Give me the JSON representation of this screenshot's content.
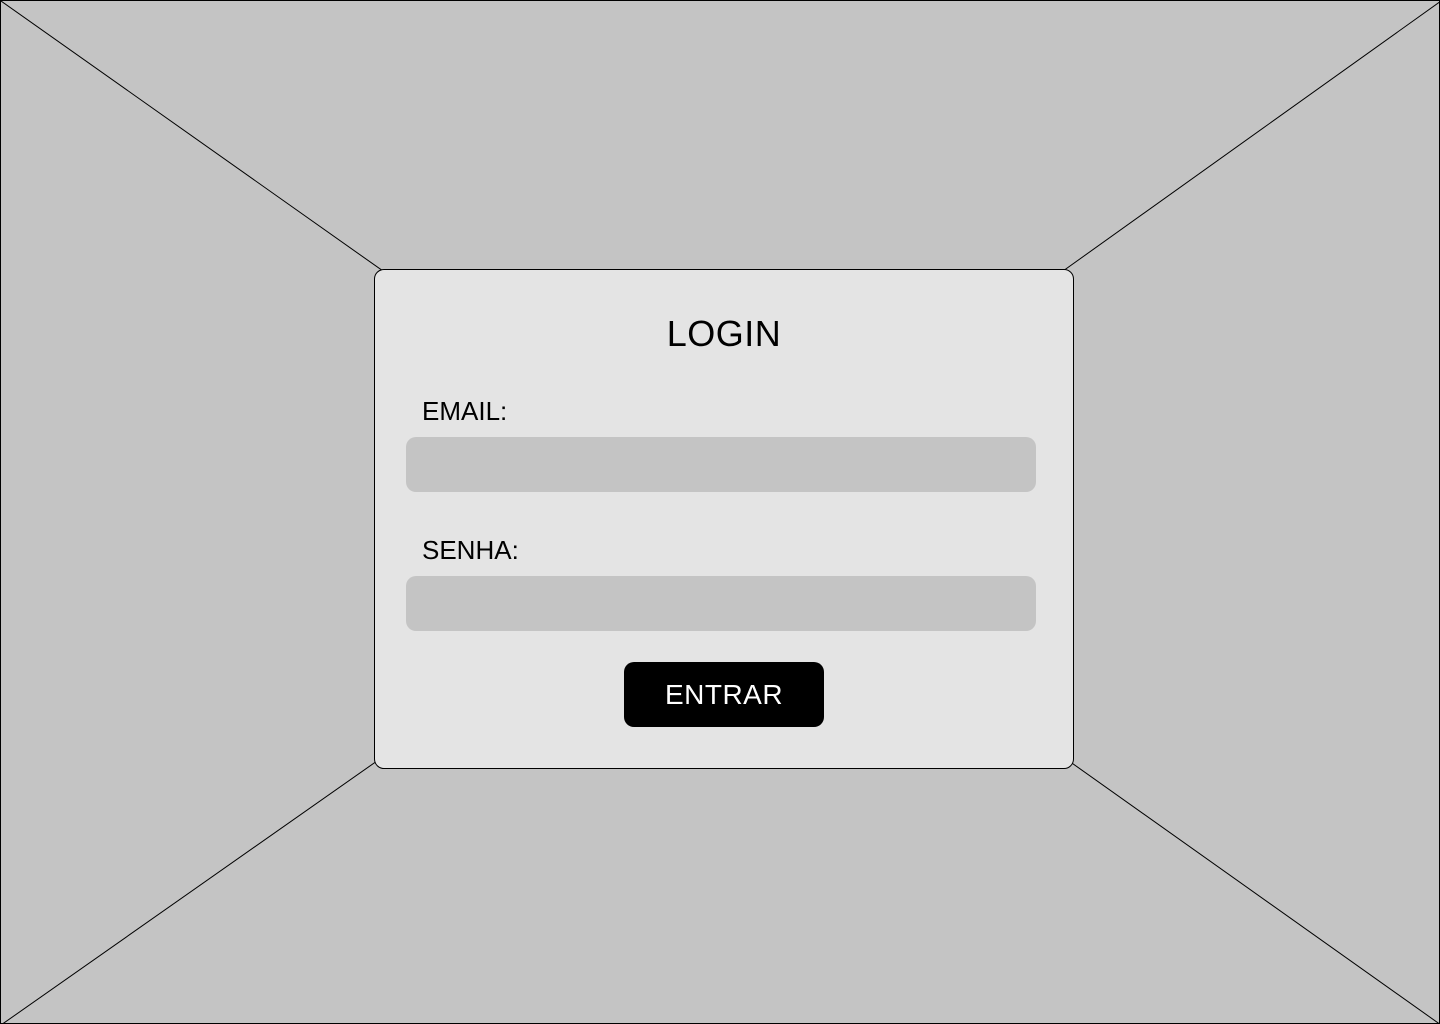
{
  "login": {
    "title": "LOGIN",
    "email_label": "EMAIL:",
    "email_value": "",
    "password_label": "SENHA:",
    "password_value": "",
    "submit_label": "ENTRAR"
  },
  "colors": {
    "background": "#c4c4c4",
    "card": "#e4e4e4",
    "input": "#c4c4c4",
    "button": "#000000",
    "button_text": "#ffffff"
  }
}
